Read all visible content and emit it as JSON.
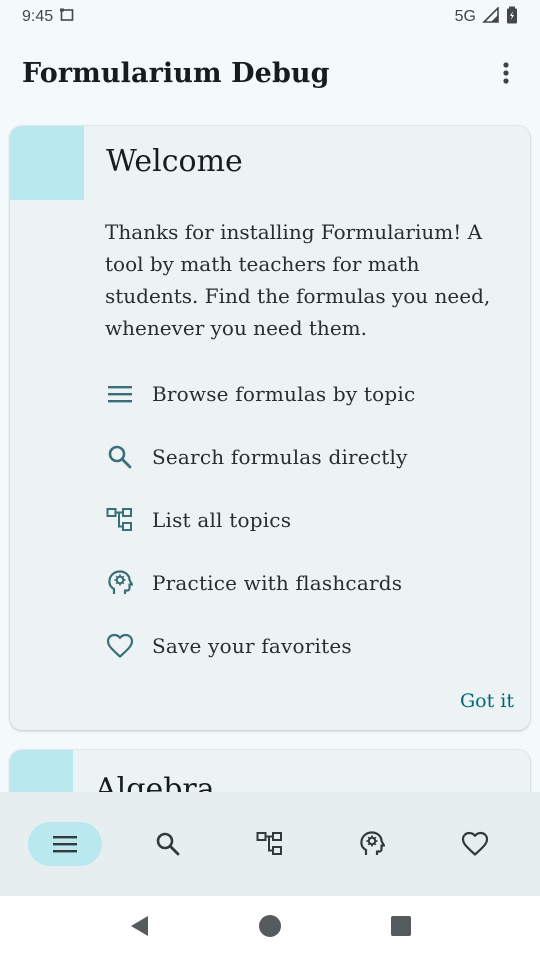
{
  "status_bar": {
    "time": "9:45",
    "network": "5G"
  },
  "app_bar": {
    "title": "Formularium Debug"
  },
  "welcome_card": {
    "title": "Welcome",
    "body": "Thanks for installing Formularium! A tool by math teachers for math students. Find the formulas you need, whenever you need them.",
    "features": [
      {
        "icon": "menu-icon",
        "label": "Browse formulas by topic"
      },
      {
        "icon": "search-icon",
        "label": "Search formulas directly"
      },
      {
        "icon": "topics-tree-icon",
        "label": "List all topics"
      },
      {
        "icon": "psychology-icon",
        "label": "Practice with flashcards"
      },
      {
        "icon": "heart-icon",
        "label": "Save your favorites"
      }
    ],
    "action": "Got it"
  },
  "next_card": {
    "title": "Algebra"
  },
  "bottom_nav": {
    "items": [
      {
        "icon": "menu-icon",
        "active": true
      },
      {
        "icon": "search-icon",
        "active": false
      },
      {
        "icon": "topics-tree-icon",
        "active": false
      },
      {
        "icon": "psychology-icon",
        "active": false
      },
      {
        "icon": "heart-icon",
        "active": false
      }
    ]
  },
  "colors": {
    "accent": "#006874",
    "accent_container": "#b9e8ef",
    "surface": "#edf3f4",
    "background": "#f4fafb"
  }
}
